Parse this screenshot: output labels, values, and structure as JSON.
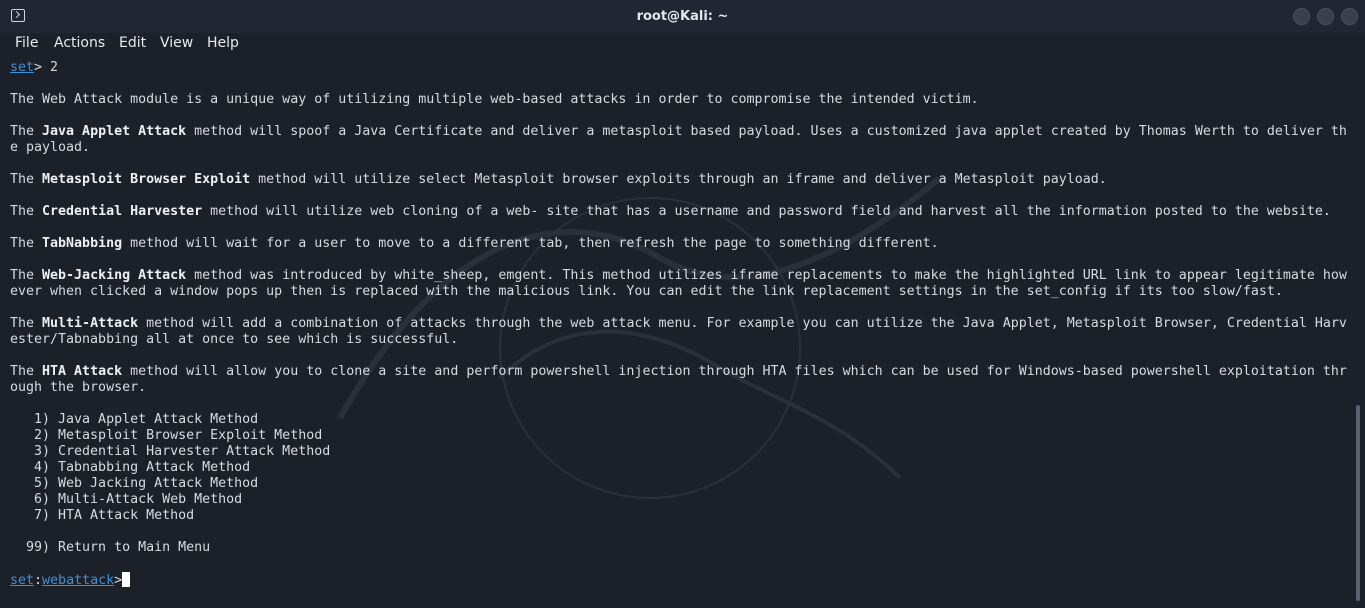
{
  "window": {
    "title": "root@Kali: ~"
  },
  "menu": {
    "file": "File",
    "actions": "Actions",
    "edit": "Edit",
    "view": "View",
    "help": "Help"
  },
  "terminal": {
    "prompt1": {
      "set": "set",
      "rest": "> 2"
    },
    "intro": "The Web Attack module is a unique way of utilizing multiple web-based attacks in order to compromise the intended victim.",
    "java": {
      "pre": "The ",
      "name": "Java Applet Attack",
      "line1": " method will spoof a Java Certificate and deliver a metasploit based payload. Uses a customized java applet created by Thomas Werth to deliver th",
      "line2": "e payload."
    },
    "msf": {
      "pre": "The ",
      "name": "Metasploit Browser Exploit",
      "rest": " method will utilize select Metasploit browser exploits through an iframe and deliver a Metasploit payload."
    },
    "cred": {
      "pre": "The ",
      "name": "Credential Harvester",
      "rest": " method will utilize web cloning of a web- site that has a username and password field and harvest all the information posted to the website."
    },
    "tab": {
      "pre": "The ",
      "name": "TabNabbing",
      "rest": " method will wait for a user to move to a different tab, then refresh the page to something different."
    },
    "jack": {
      "pre": "The ",
      "name": "Web-Jacking Attack",
      "line1": " method was introduced by white_sheep, emgent. This method utilizes iframe replacements to make the highlighted URL link to appear legitimate how",
      "line2": "ever when clicked a window pops up then is replaced with the malicious link. You can edit the link replacement settings in the set_config if its too slow/fast."
    },
    "multi": {
      "pre": "The ",
      "name": "Multi-Attack",
      "line1": " method will add a combination of attacks through the web attack menu. For example you can utilize the Java Applet, Metasploit Browser, Credential Harv",
      "line2": "ester/Tabnabbing all at once to see which is successful."
    },
    "hta": {
      "pre": "The ",
      "name": "HTA Attack",
      "line1": " method will allow you to clone a site and perform powershell injection through HTA files which can be used for Windows-based powershell exploitation thr",
      "line2": "ough the browser."
    },
    "options": [
      "   1) Java Applet Attack Method",
      "   2) Metasploit Browser Exploit Method",
      "   3) Credential Harvester Attack Method",
      "   4) Tabnabbing Attack Method",
      "   5) Web Jacking Attack Method",
      "   6) Multi-Attack Web Method",
      "   7) HTA Attack Method"
    ],
    "return_option": "  99) Return to Main Menu",
    "prompt2": {
      "set": "set",
      "colon": ":",
      "module": "webattack",
      "gt": ">"
    }
  }
}
